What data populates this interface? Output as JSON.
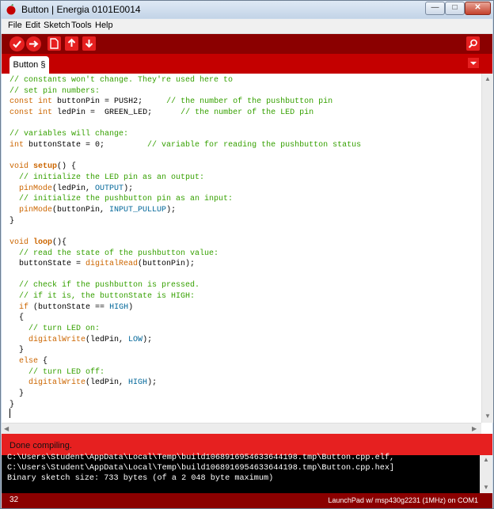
{
  "window": {
    "title": "Button | Energia 0101E0014"
  },
  "menu": [
    "File",
    "Edit",
    "Sketch",
    "Tools",
    "Help"
  ],
  "toolbar": {
    "buttons": [
      "verify-icon",
      "upload-icon",
      "new-icon",
      "open-icon",
      "save-icon",
      "serial-monitor-icon"
    ]
  },
  "tab": {
    "label": "Button §"
  },
  "editor": {
    "language": "energia",
    "line_count": 32
  },
  "status": {
    "message": "Done compiling."
  },
  "console": {
    "lines": [
      "C:\\Users\\Student\\AppData\\Local\\Temp\\build1068916954633644198.tmp\\Button.cpp.elf,",
      "C:\\Users\\Student\\AppData\\Local\\Temp\\build1068916954633644198.tmp\\Button.cpp.hex]",
      "Binary sketch size: 733 bytes (of a 2 048 byte maximum)"
    ]
  },
  "footer": {
    "line_number": "32",
    "board": "LaunchPad w/ msp430g2231 (1MHz) on COM1"
  },
  "colors": {
    "toolbar_bg": "#8b0000",
    "accent": "#e62020",
    "tab_strip": "#c40000",
    "comment": "#35a000",
    "keyword": "#cc6600",
    "constant": "#006699"
  }
}
